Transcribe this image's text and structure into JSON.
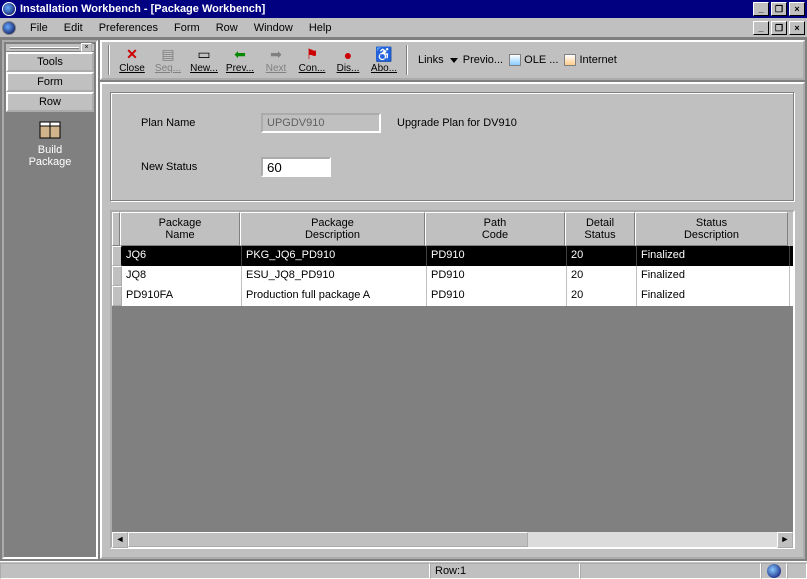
{
  "window": {
    "title": "Installation Workbench - [Package Workbench]"
  },
  "menu": {
    "file": "File",
    "edit": "Edit",
    "preferences": "Preferences",
    "form": "Form",
    "row": "Row",
    "window": "Window",
    "help": "Help"
  },
  "sidebar": {
    "tools": "Tools",
    "form": "Form",
    "row": "Row",
    "build_package": "Build\nPackage"
  },
  "toolbar": {
    "close": "Close",
    "seq": "Seq...",
    "new": "New...",
    "prev": "Prev...",
    "next": "Next",
    "con": "Con...",
    "dis": "Dis...",
    "abo": "Abo...",
    "links": "Links",
    "previo": "Previo...",
    "ole": "OLE ...",
    "internet": "Internet"
  },
  "form": {
    "plan_name_label": "Plan Name",
    "plan_name_value": "UPGDV910",
    "plan_desc": "Upgrade Plan for DV910",
    "new_status_label": "New Status",
    "new_status_value": "60"
  },
  "grid": {
    "headers": {
      "pkg_name": "Package\nName",
      "pkg_desc": "Package\nDescription",
      "path_code": "Path\nCode",
      "detail_status": "Detail\nStatus",
      "status_desc": "Status\nDescription"
    },
    "rows": [
      {
        "name": "JQ6",
        "desc": "PKG_JQ6_PD910",
        "path": "PD910",
        "status": "20",
        "sdesc": "Finalized"
      },
      {
        "name": "JQ8",
        "desc": "ESU_JQ8_PD910",
        "path": "PD910",
        "status": "20",
        "sdesc": "Finalized"
      },
      {
        "name": "PD910FA",
        "desc": "Production full package A",
        "path": "PD910",
        "status": "20",
        "sdesc": "Finalized"
      }
    ]
  },
  "statusbar": {
    "row": "Row:1"
  }
}
